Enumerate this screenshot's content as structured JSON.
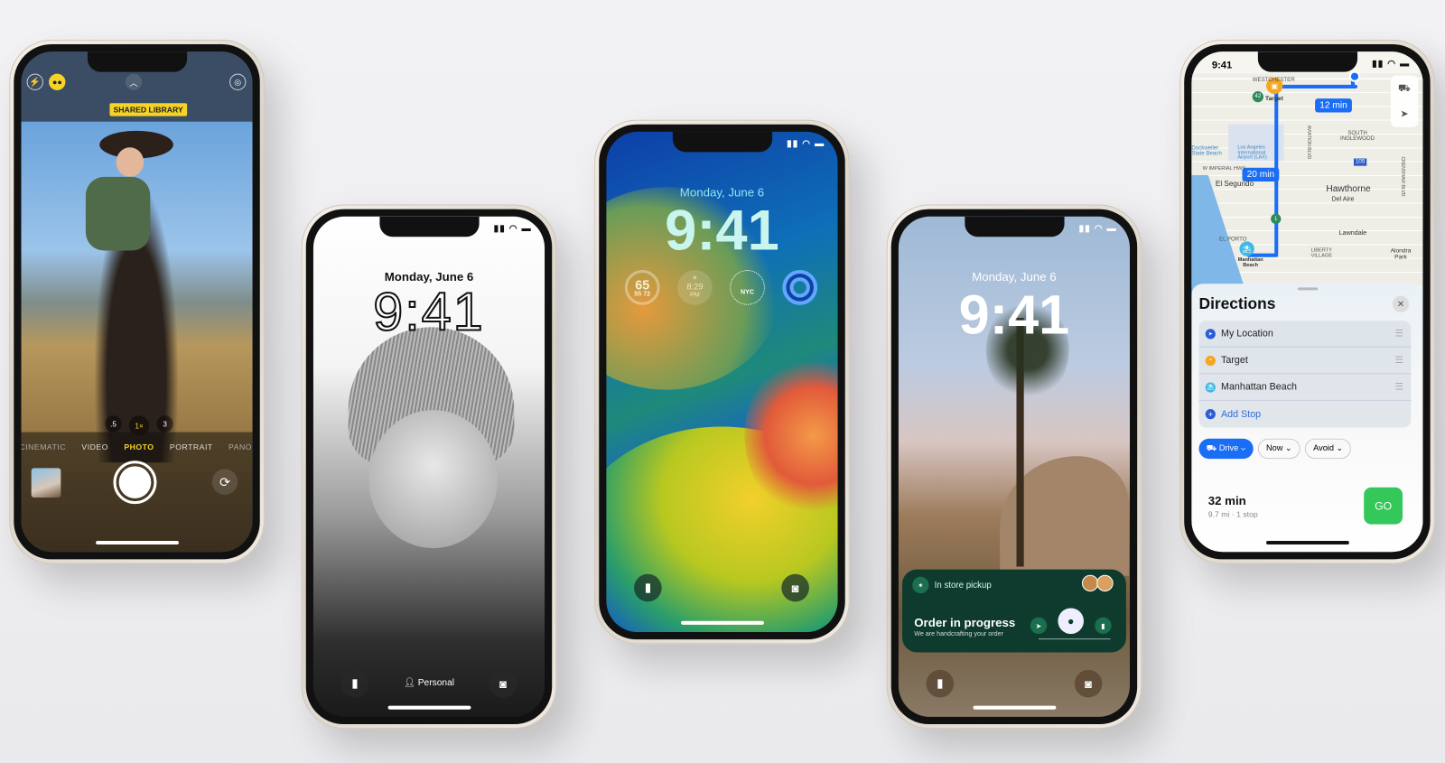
{
  "camera": {
    "shared_library_label": "SHARED LIBRARY",
    "zoom_levels": [
      ".5",
      "1×",
      "3"
    ],
    "modes": [
      "CINEMATIC",
      "VIDEO",
      "PHOTO",
      "PORTRAIT",
      "PANO"
    ],
    "selected_mode": "PHOTO",
    "icons": [
      "flash-icon",
      "shared-library-icon",
      "chevron-up-icon",
      "live-photo-icon",
      "thumbnail",
      "shutter-button",
      "flip-camera-icon"
    ],
    "accent": "#f5d327"
  },
  "lockscreen_bw": {
    "date": "Monday, June 6",
    "time": "9:41",
    "focus_label": "Personal"
  },
  "lockscreen_wallpaper": {
    "date": "Monday, June 6",
    "time": "9:41",
    "widgets": {
      "weather_temp": "65",
      "weather_low": "55",
      "weather_high": "72",
      "sunset_time": "8:29",
      "sunset_ampm": "PM",
      "clock_city": "NYC"
    }
  },
  "lockscreen_desert": {
    "date": "Monday, June 6",
    "time": "9:41",
    "live_activity": {
      "header": "In store pickup",
      "title": "Order in progress",
      "subtitle": "We are handcrafting your order",
      "brand_color": "#0f3b2e"
    }
  },
  "maps": {
    "status_time": "9:41",
    "map_labels": [
      "WESTCHESTER",
      "Target",
      "SOUTH INGLEWOOD",
      "Dockweiler State Beach",
      "Los Angeles International Airport (LAX)",
      "W IMPERIAL HWY",
      "AVIATION BLVD",
      "El Segundo",
      "Hawthorne",
      "Del Aire",
      "EL PORTO",
      "Lawndale",
      "LIBERTY VILLAGE",
      "Alondra Park",
      "Manhattan Beach",
      "CRENSHAW BLVD"
    ],
    "route_badges": [
      "12 min",
      "20 min"
    ],
    "highway_shields": [
      "42",
      "105",
      "1"
    ],
    "sheet_title": "Directions",
    "stops": [
      "My Location",
      "Target",
      "Manhattan Beach"
    ],
    "add_stop": "Add Stop",
    "options": {
      "drive": "Drive",
      "now": "Now",
      "avoid": "Avoid"
    },
    "summary_time": "32 min",
    "summary_detail": "9.7 mi · 1 stop",
    "go_label": "GO",
    "route_color": "#1a6ef5",
    "go_color": "#34c759"
  }
}
